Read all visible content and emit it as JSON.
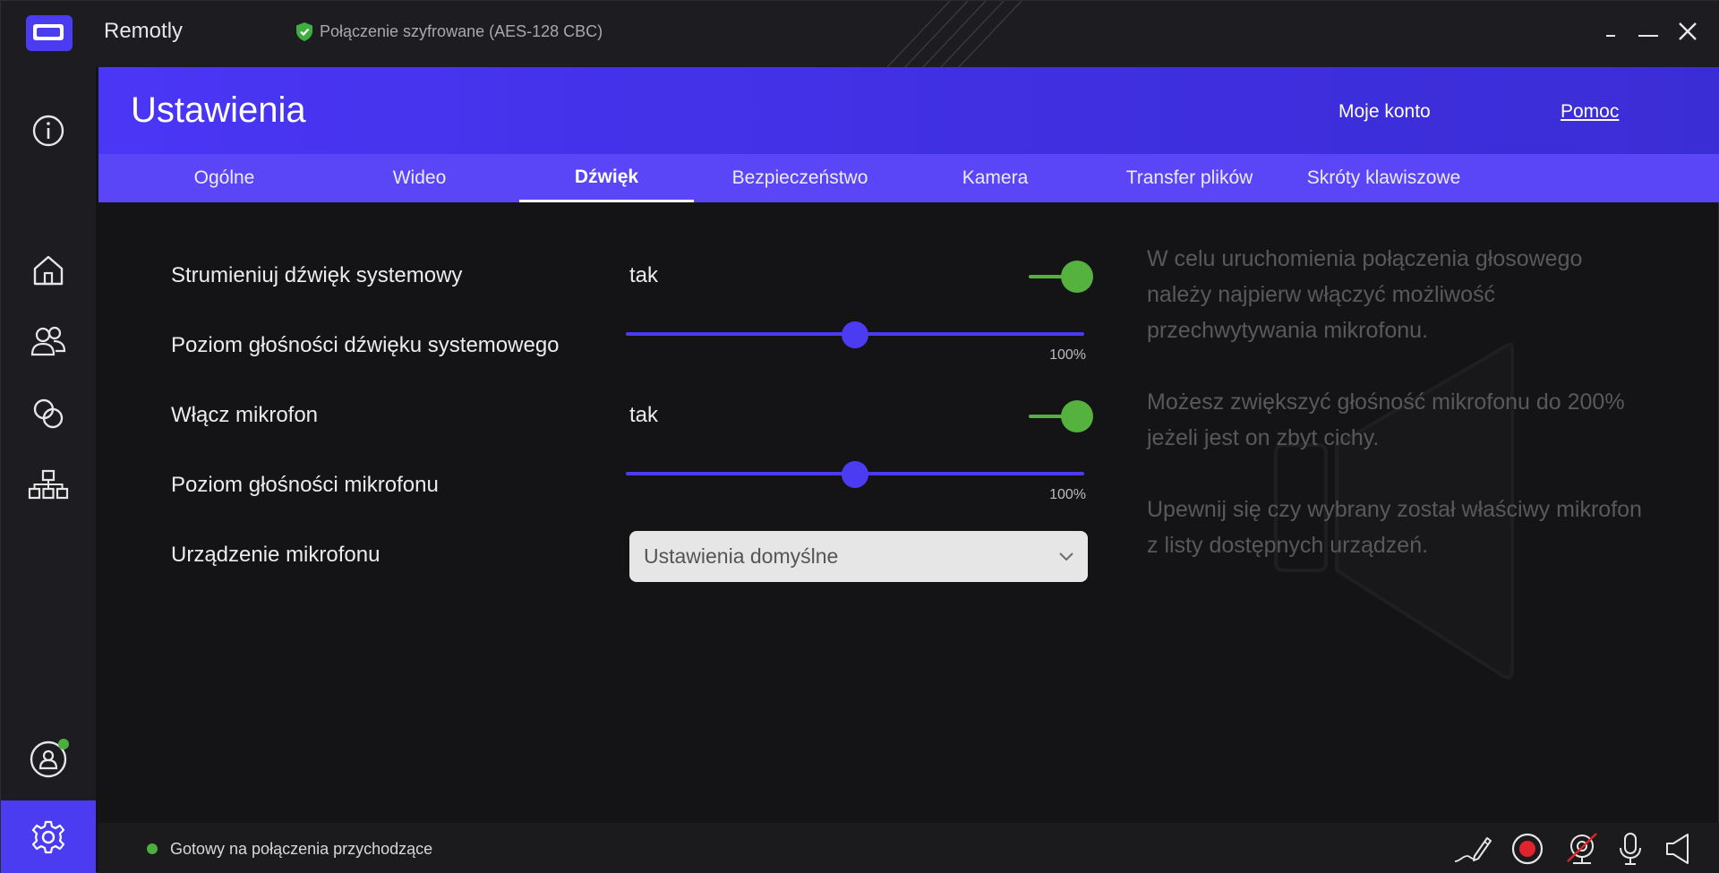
{
  "titlebar": {
    "app_name": "Remotly",
    "security_status": "Połączenie szyfrowane (AES-128 CBC)",
    "icons": [
      "app-logo-icon",
      "shield-check-icon",
      "minimize-icon",
      "maximize-icon",
      "close-icon"
    ]
  },
  "sidebar": {
    "items": [
      {
        "name": "info",
        "icon": "info-icon"
      },
      {
        "name": "home",
        "icon": "home-icon"
      },
      {
        "name": "contacts",
        "icon": "users-icon"
      },
      {
        "name": "sessions",
        "icon": "circles-icon"
      },
      {
        "name": "devices",
        "icon": "network-icon"
      },
      {
        "name": "account",
        "icon": "user-icon",
        "online": true
      },
      {
        "name": "settings",
        "icon": "gear-icon",
        "active": true
      }
    ]
  },
  "header": {
    "title": "Ustawienia",
    "account_link": "Moje konto",
    "help_link": "Pomoc"
  },
  "tabs": [
    {
      "label": "Ogólne"
    },
    {
      "label": "Wideo"
    },
    {
      "label": "Dźwięk",
      "active": true
    },
    {
      "label": "Bezpieczeństwo"
    },
    {
      "label": "Kamera"
    },
    {
      "label": "Transfer plików"
    },
    {
      "label": "Skróty klawiszowe"
    }
  ],
  "settings": {
    "stream_system_audio": {
      "label": "Strumieniuj dźwięk systemowy",
      "value": "tak",
      "enabled": true
    },
    "system_volume": {
      "label": "Poziom głośności dźwięku systemowego",
      "percent": "100%",
      "level": 0.5
    },
    "enable_microphone": {
      "label": "Włącz mikrofon",
      "value": "tak",
      "enabled": true
    },
    "microphone_volume": {
      "label": "Poziom głośności mikrofonu",
      "percent": "100%",
      "level": 0.5
    },
    "microphone_device": {
      "label": "Urządzenie mikrofonu",
      "selected": "Ustawienia domyślne"
    }
  },
  "info": {
    "paragraphs": [
      "W celu uruchomienia połączenia głosowego należy najpierw włączyć możliwość przechwytywania mikrofonu.",
      "Możesz zwiększyć głośność mikrofonu do 200% jeżeli jest on zbyt cichy.",
      "Upewnij się czy wybrany został właściwy mikrofon z listy dostępnych urządzeń."
    ]
  },
  "statusbar": {
    "status": "Gotowy na połączenia przychodzące",
    "tools": [
      "pen-icon",
      "record-icon",
      "camera-off-icon",
      "microphone-icon",
      "speaker-icon"
    ]
  },
  "colors": {
    "accent": "#4b3cf2",
    "tab_bar": "#5a46f7",
    "toggle_on": "#56b23e",
    "status_ok": "#4caf3d",
    "record": "#e0242c"
  }
}
